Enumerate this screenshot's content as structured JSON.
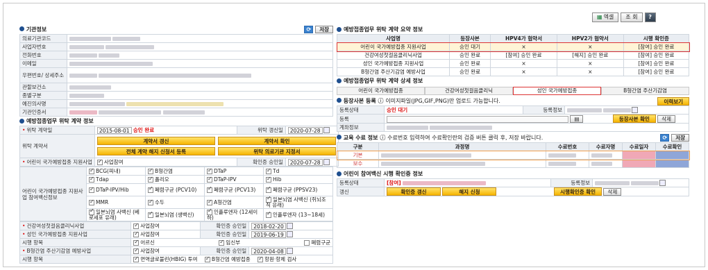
{
  "toolbar": {
    "btn1": "엑셀",
    "btn2": "조 회",
    "btn3": "?"
  },
  "left": {
    "section1": "기관정보",
    "save": "저장",
    "fields": [
      "의료기관코드",
      "사업자번호",
      "전화번호",
      "이메일",
      "우편번호/ 상세주소",
      "관할보건소",
      "종별구분",
      "예진의사명",
      "기관인증서"
    ],
    "section2": "예방접종업무 위탁 계약 정보",
    "contract_date_label": "위탁 계약일",
    "contract_date": "2015-08-01",
    "contract_status": "승인 완료",
    "renew_label": "위탁 갱신일",
    "renew_date": "2020-07-28",
    "contract_doc_label": "위탁 계약서",
    "btn_renew": "계약서 갱신",
    "btn_check": "계약서 확인",
    "btn_full": "전체 계약 해지 신청서 등록",
    "btn_cert": "위탁 의료기관 지정서",
    "child_label": "어린이 국가예방접종 지원사업",
    "participate": "사업참여",
    "confirm_date_label": "확인증 승인일",
    "child_confirm": "2020-07-28",
    "child_block_label": "어린이 국가예방접종 지원사업 참여백신정보",
    "vaccines": [
      [
        "BCG(피내)",
        "B형간염",
        "DTaP",
        "Td"
      ],
      [
        "Tdap",
        "폴리오",
        "DTaP-IPV",
        "Hib"
      ],
      [
        "DTaP-IPV/Hib",
        "폐렴구균 (PCV10)",
        "폐렴구균 (PCV13)",
        "폐렴구균 (PPSV23)"
      ],
      [
        "MMR",
        "수두",
        "A형간염",
        "일본뇌염 사백신 (쥐뇌조직 유래)"
      ],
      [
        "일본뇌염 사백신 (베로세포 유래)",
        "일본뇌염 (생백신)",
        "인플루엔자 (12세이하)",
        "인플루엔자 (13~18세)"
      ]
    ],
    "flu_label": "건강여성첫걸음클리닉사업",
    "flu_date": "2018-02-20",
    "adult_label": "성인 국가예방접종 지원사업",
    "adult_date": "2019-06-19",
    "target_label": "시행 항목",
    "target_items": [
      "어르신",
      "임신부",
      "폐렴구균"
    ],
    "hep_label": "B형간염 주산기감염 예방사업",
    "hep_date": "2020-04-08",
    "hep_items": [
      "면역글로불린(HBIG) 투여",
      "B형간염 예방접종",
      "항원·항체 검사"
    ]
  },
  "right": {
    "section1": "예방접종업무 위탁 계약 요약 정보",
    "summary_headers": [
      "사업명",
      "등장사본",
      "HPV4가 협약서",
      "HPV2가 협약서",
      "시행 확인증"
    ],
    "summary_rows": [
      [
        "어린이 국가예방접종 지원사업",
        "승인 대기",
        "×",
        "×",
        "[참여] 승인 완료"
      ],
      [
        "건강여성첫걸음클리닉사업",
        "승인 완료",
        "[참여] 승인 완료",
        "[해지] 승인 완료",
        "[참여] 승인 완료"
      ],
      [
        "성인 국가예방접종 지원사업",
        "승인 완료",
        "×",
        "×",
        "[참여] 승인 완료"
      ],
      [
        "B형간염 주산기감염 예방사업",
        "승인 완료",
        "×",
        "×",
        "[참여] 승인 완료"
      ]
    ],
    "section2": "예방접종업무 위탁 계약 상세 정보",
    "tabs": [
      "어린이 국가예방접종",
      "건강여성첫걸음클리닉",
      "성인 국가예방접종",
      "B형간염 주산기감염"
    ],
    "sub1": "등장사본 등록",
    "sub1_note": "이미지파일(JPG,GIF,PNG)만 업로드 가능합니다.",
    "history_btn": "이력보기",
    "reg_status_label": "등록상태",
    "reg_status": "승인 대기",
    "reg_info_label": "등록정보",
    "reg_label": "등록",
    "btn_reg_check": "등장사본 확인",
    "btn_delete": "삭제",
    "account_label": "계좌정보",
    "sub2": "교육 수료 정보",
    "sub2_note": "수료번호 입력하여 수료확인란의 검증 버튼 클릭 후, 저장 바랍니다.",
    "edu_headers": [
      "구분",
      "과정명",
      "수료번호",
      "수료자명",
      "수료일자",
      "수료확인"
    ],
    "edu_rows": [
      "기본",
      "보수"
    ],
    "save": "저장",
    "sub3": "어린이 참여백신 시행 확인증 정보",
    "status_label": "등록상태",
    "status_val": "[참여]",
    "info_label": "등록정보",
    "renew_label": "갱신",
    "btn_confirm_renew": "확인증 갱신",
    "btn_cancel": "해지 신청",
    "btn_view": "시행확인증 확인",
    "delete": "삭제"
  }
}
